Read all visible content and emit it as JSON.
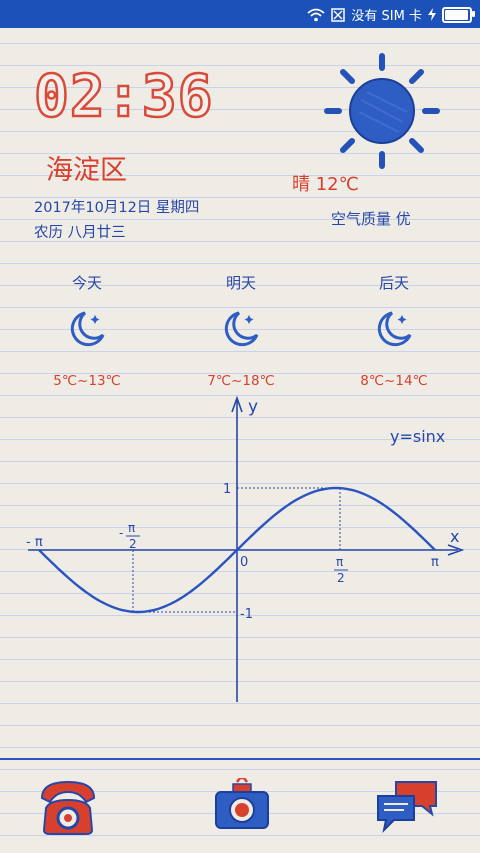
{
  "status_bar": {
    "carrier": "没有 SIM 卡",
    "battery_level": 0.9
  },
  "clock": {
    "time": "02:36"
  },
  "location": {
    "district": "海淀区"
  },
  "date": {
    "solar": "2017年10月12日 星期四",
    "lunar": "农历 八月廿三"
  },
  "weather": {
    "icon": "sun-icon",
    "current": "晴 12℃",
    "air_quality": "空气质量 优",
    "forecast": [
      {
        "day": "今天",
        "icon": "moon-icon",
        "temp": "5℃~13℃"
      },
      {
        "day": "明天",
        "icon": "moon-icon",
        "temp": "7℃~18℃"
      },
      {
        "day": "后天",
        "icon": "moon-icon",
        "temp": "8℃~14℃"
      }
    ]
  },
  "graph": {
    "formula": "y=sinx",
    "axis_x": "x",
    "axis_y": "y",
    "origin": "0",
    "one": "1",
    "neg_one": "-1",
    "neg_pi": "- π",
    "pi": "π",
    "pi_num": "π",
    "two": "2",
    "neg_sign": "-"
  },
  "dock": [
    {
      "name": "phone",
      "icon": "phone-icon"
    },
    {
      "name": "camera",
      "icon": "camera-icon"
    },
    {
      "name": "messages",
      "icon": "chat-icon"
    }
  ],
  "colors": {
    "status_bar": "#1b51b8",
    "ink_blue": "#2747a8",
    "ink_red": "#d8402e",
    "paper": "#efece6"
  }
}
